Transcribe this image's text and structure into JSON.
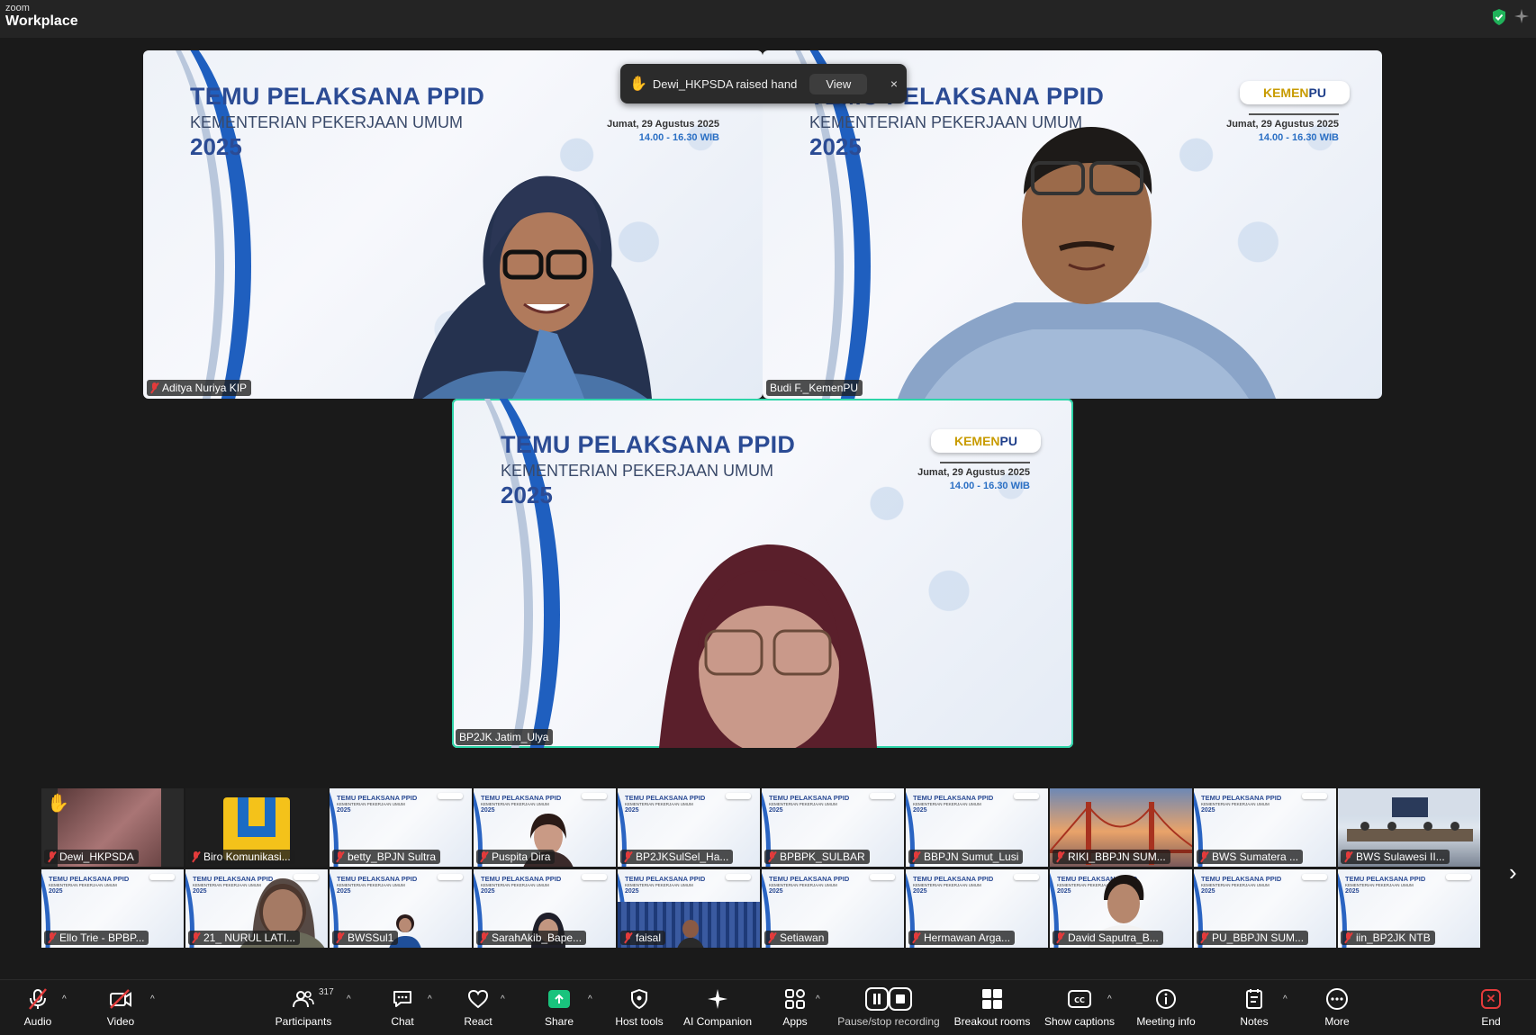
{
  "app": {
    "brand_small": "zoom",
    "brand_big": "Workplace"
  },
  "notification": {
    "text": "Dewi_HKPSDA raised hand",
    "view_label": "View",
    "close_label": "×"
  },
  "slide": {
    "title": "TEMU PELAKSANA PPID",
    "subtitle": "KEMENTERIAN PEKERJAAN UMUM",
    "year": "2025",
    "date": "Jumat, 29 Agustus 2025",
    "time": "14.00 - 16.30 WIB",
    "logo_a": "KEMEN",
    "logo_b": "PU"
  },
  "main_tiles": [
    {
      "name": "Aditya Nuriya KIP"
    },
    {
      "name": "Budi F._KemenPU"
    },
    {
      "name": "BP2JK Jatim_Ulya"
    }
  ],
  "thumbnails_row1": [
    {
      "name": "Dewi_HKPSDA"
    },
    {
      "name": "Biro Komunikasi..."
    },
    {
      "name": "betty_BPJN Sultra"
    },
    {
      "name": "Puspita Dira"
    },
    {
      "name": "BP2JKSulSel_Ha..."
    },
    {
      "name": "BPBPK_SULBAR"
    },
    {
      "name": "BBPJN Sumut_Lusi"
    },
    {
      "name": "RIKI_BBPJN SUM..."
    },
    {
      "name": "BWS Sumatera ..."
    },
    {
      "name": "BWS Sulawesi II..."
    }
  ],
  "thumbnails_row2": [
    {
      "name": "Ello Trie - BPBP..."
    },
    {
      "name": "21_ NURUL LATI..."
    },
    {
      "name": "BWSSul1"
    },
    {
      "name": "SarahAkib_Bape..."
    },
    {
      "name": "faisal"
    },
    {
      "name": "Setiawan"
    },
    {
      "name": "Hermawan Arga..."
    },
    {
      "name": "David Saputra_B..."
    },
    {
      "name": "PU_BBPJN SUM..."
    },
    {
      "name": "iin_BP2JK NTB"
    }
  ],
  "toolbar": {
    "audio": "Audio",
    "video": "Video",
    "participants": "Participants",
    "participants_count": "317",
    "chat": "Chat",
    "react": "React",
    "share": "Share",
    "host_tools": "Host tools",
    "ai_companion": "AI Companion",
    "apps": "Apps",
    "recording": "Pause/stop recording",
    "breakout": "Breakout rooms",
    "captions": "Show captions",
    "meeting_info": "Meeting info",
    "notes": "Notes",
    "more": "More",
    "end": "End"
  },
  "colors": {
    "accent_green": "#2dd4a8",
    "share_green": "#19c37d",
    "mute_red": "#e23b3b",
    "slide_blue": "#2b4b94"
  }
}
